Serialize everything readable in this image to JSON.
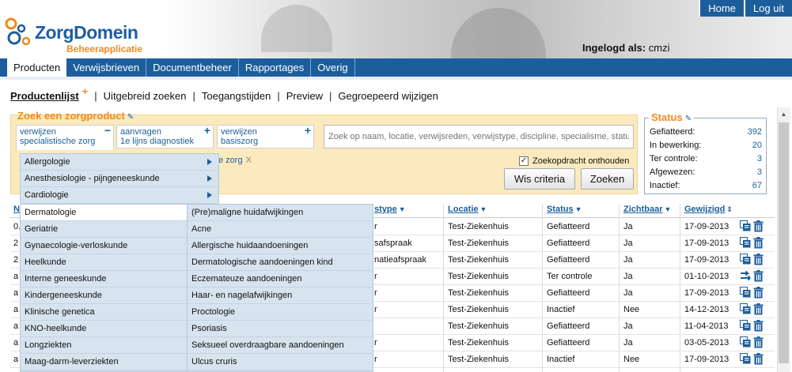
{
  "header": {
    "logo_text": "ZorgDomein",
    "logo_sub": "Beheerapplicatie",
    "login_label": "Ingelogd als:",
    "login_user": "cmzi",
    "top_buttons": [
      "Home",
      "Log uit"
    ]
  },
  "nav": {
    "tabs": [
      "Producten",
      "Verwijsbrieven",
      "Documentbeheer",
      "Rapportages",
      "Overig"
    ],
    "active": "Producten"
  },
  "subnav": {
    "items": [
      "Productenlijst",
      "Uitgebreid zoeken",
      "Toegangstijden",
      "Preview",
      "Gegroepeerd wijzigen"
    ],
    "plus": "+"
  },
  "search": {
    "title": "Zoek een zorgproduct",
    "chips": [
      {
        "line1": "verwijzen",
        "line2": "specialistische zorg",
        "btn": "−"
      },
      {
        "line1": "aanvragen",
        "line2": "1e lijns diagnostiek",
        "btn": "+"
      },
      {
        "line1": "verwijzen",
        "line2": "basiszorg",
        "btn": "+"
      }
    ],
    "placeholder": "Zoek op naam, locatie, verwijsreden, verwijstype, discipline, specialisme, status",
    "tag": "e zorg",
    "tag_close": "X",
    "remember_label": "Zoekopdracht onthouden",
    "remember_checked": "✓",
    "btn_clear": "Wis criteria",
    "btn_search": "Zoeken"
  },
  "status": {
    "title": "Status",
    "rows": [
      {
        "label": "Gefiatteerd:",
        "value": "392"
      },
      {
        "label": "In bewerking:",
        "value": "20"
      },
      {
        "label": "Ter controle:",
        "value": "3"
      },
      {
        "label": "Afgewezen:",
        "value": "3"
      },
      {
        "label": "Inactief:",
        "value": "67"
      }
    ]
  },
  "table": {
    "headers": {
      "first": "N",
      "verwijstype": "stype",
      "locatie": "Locatie",
      "status": "Status",
      "zichtbaar": "Zichtbaar",
      "gewijzigd": "Gewijzigd"
    },
    "rows": [
      {
        "c1": "0.",
        "type": "r",
        "locatie": "Test-Ziekenhuis",
        "status": "Gefiatteerd",
        "zichtbaar": "Ja",
        "datum": "17-09-2013",
        "action": "copy"
      },
      {
        "c1": "2",
        "type": "safspraak",
        "locatie": "Test-Ziekenhuis",
        "status": "Gefiatteerd",
        "zichtbaar": "Ja",
        "datum": "17-09-2013",
        "action": "copy"
      },
      {
        "c1": "2",
        "type": "natieafspraak",
        "locatie": "Test-Ziekenhuis",
        "status": "Gefiatteerd",
        "zichtbaar": "Ja",
        "datum": "17-09-2013",
        "action": "copy"
      },
      {
        "c1": "a",
        "type": "r",
        "locatie": "Test-Ziekenhuis",
        "status": "Ter controle",
        "zichtbaar": "Ja",
        "datum": "01-10-2013",
        "action": "swap"
      },
      {
        "c1": "a",
        "type": "r",
        "locatie": "Test-Ziekenhuis",
        "status": "Gefiatteerd",
        "zichtbaar": "Ja",
        "datum": "17-09-2013",
        "action": "copy"
      },
      {
        "c1": "a",
        "type": "r",
        "locatie": "Test-Ziekenhuis",
        "status": "Inactief",
        "zichtbaar": "Nee",
        "datum": "14-12-2013",
        "action": "copy"
      },
      {
        "c1": "a",
        "type": "",
        "locatie": "Test-Ziekenhuis",
        "status": "Gefiatteerd",
        "zichtbaar": "Ja",
        "datum": "11-04-2013",
        "action": "copy"
      },
      {
        "c1": "a",
        "type": "r",
        "locatie": "Test-Ziekenhuis",
        "status": "Gefiatteerd",
        "zichtbaar": "Ja",
        "datum": "03-05-2013",
        "action": "copy"
      },
      {
        "c1": "a",
        "type": "r",
        "locatie": "Test-Ziekenhuis",
        "status": "Inactief",
        "zichtbaar": "Nee",
        "datum": "17-09-2013",
        "action": "copy"
      }
    ]
  },
  "menus": {
    "level1": [
      "Allergologie",
      "Anesthesiologie - pijngeneeskunde",
      "Cardiologie"
    ],
    "level2": [
      "Dermatologie",
      "Geriatrie",
      "Gynaecologie-verloskunde",
      "Heelkunde",
      "Interne geneeskunde",
      "Kindergeneeskunde",
      "Klinische genetica",
      "KNO-heelkunde",
      "Longziekten",
      "Maag-darm-leverziekten"
    ],
    "level2_active": "Dermatologie",
    "level3": [
      "(Pre)maligne huidafwijkingen",
      "Acne",
      "Allergische huidaandoeningen",
      "Dermatologische aandoeningen kind",
      "Eczemateuze aandoeningen",
      "Haar- en nagelafwijkingen",
      "Proctologie",
      "Psoriasis",
      "Seksueel overdraagbare aandoeningen",
      "Ulcus cruris"
    ]
  },
  "colors": {
    "brand_blue": "#1c5e9c",
    "accent_orange": "#f08a1d",
    "search_bg": "#fbeabd",
    "menu_bg": "#d7e3ee"
  }
}
